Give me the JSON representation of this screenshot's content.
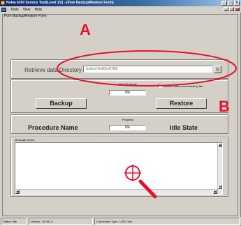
{
  "window": {
    "title": "Nokia 6300 Service Tool(Level 1/2) - [Pure Backup/Restore Form]",
    "controls": [
      "_",
      "□",
      "×"
    ],
    "mdi_controls": [
      "_",
      "□",
      "×"
    ]
  },
  "menu": {
    "items": [
      {
        "label": "Tools"
      },
      {
        "label": "View"
      },
      {
        "label": "Help"
      }
    ]
  },
  "form": {
    "title": "Pure Backup/Restore Form"
  },
  "retrieve": {
    "label": "Retrieve data Directory",
    "path": "\\Users\\Ted\\Dn\\6700\\"
  },
  "progress": {
    "total_label": "Total Progress",
    "total_value": "0%",
    "restore_checkbox_label": "Restore with current backup file",
    "restore_checkbox_checked": false,
    "progress_label": "Progress",
    "progress_value": "0%"
  },
  "buttons": {
    "backup": "Backup",
    "restore": "Restore"
  },
  "state": {
    "procedure_label": "Procedure Name",
    "state_label": "Idle State"
  },
  "message": {
    "label": "Message Memo",
    "content": ""
  },
  "status": {
    "status": "Status: Idle",
    "version": "Version : A0.96_8",
    "connection": "Connection Type : USB Only"
  },
  "annotations": {
    "label_a": "A",
    "label_b": "B",
    "color": "#e8102a"
  },
  "icons": {
    "app": "app-icon",
    "menu": "menu-app-icon",
    "loupe": "magnifier-crosshair-icon"
  }
}
